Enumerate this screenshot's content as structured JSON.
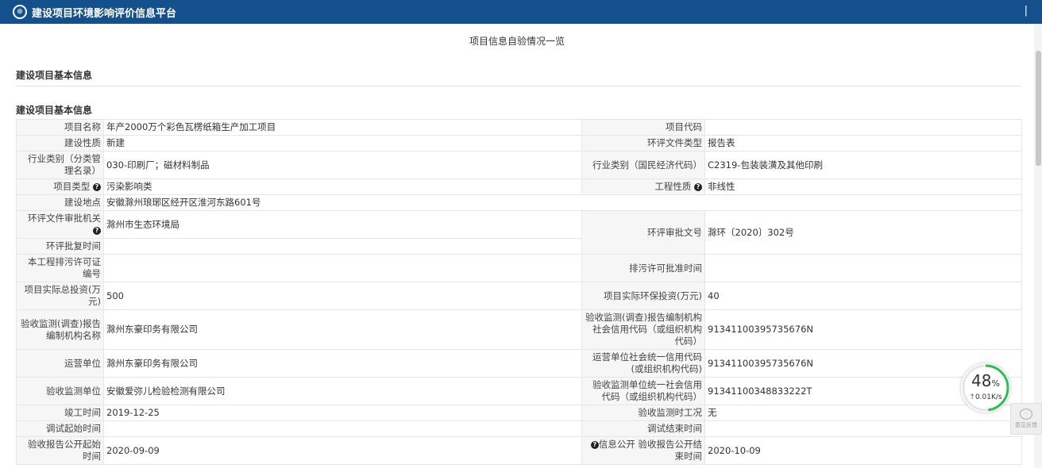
{
  "header": {
    "title": "建设项目环境影响评价信息平台",
    "logo_text": "⊕",
    "right_mark": "|"
  },
  "page_heading": "项目信息自验情况一览",
  "section1_title": "建设项目基本信息",
  "section2_title": "建设项目基本信息",
  "fields": {
    "project_name_label": "项目名称",
    "project_name": "年产2000万个彩色瓦楞纸箱生产加工项目",
    "project_code_label": "项目代码",
    "project_code": "",
    "nature_label": "建设性质",
    "nature": "新建",
    "doc_type_label": "环评文件类型",
    "doc_type": "报告表",
    "industry_cat_label": "行业类别（分类管理名录）",
    "industry_cat": "030-印刷厂；磁材料制品",
    "industry_nat_label": "行业类别（国民经济代码）",
    "industry_nat": "C2319-包装装潢及其他印刷",
    "project_type_label": "项目类型",
    "project_type": "污染影响类",
    "eng_nature_label": "工程性质",
    "eng_nature": "非线性",
    "location_label": "建设地点",
    "location": "安徽滁州琅琊区经开区淮河东路601号",
    "approval_org_label": "环评文件审批机关",
    "approval_org": "滁州市生态环境局",
    "approval_no_label": "环评审批文号",
    "approval_no": "滁环〔2020〕302号",
    "approval_time_label": "环评批复时间",
    "approval_time": "",
    "permit_no_label": "本工程排污许可证编号",
    "permit_no": "",
    "permit_time_label": "排污许可批准时间",
    "permit_time": "",
    "total_invest_label": "项目实际总投资(万元)",
    "total_invest": "500",
    "env_invest_label": "项目实际环保投资(万元)",
    "env_invest": "40",
    "report_org_label": "验收监测(调查)报告编制机构名称",
    "report_org": "滁州东豪印务有限公司",
    "report_org_code_label": "验收监测(调查)报告编制机构社会信用代码（或组织机构代码）",
    "report_org_code": "91341100395735676N",
    "operator_label": "运营单位",
    "operator": "滁州东豪印务有限公司",
    "operator_code_label": "运营单位社会统一信用代码(或组织机构代码)",
    "operator_code": "91341100395735676N",
    "monitor_org_label": "验收监测单位",
    "monitor_org": "安徽爱弥儿检验检测有限公司",
    "monitor_org_code_label": "验收监测单位统一社会信用代码（或组织机构代码）",
    "monitor_org_code": "91341100348833222T",
    "completion_time_label": "竣工时间",
    "completion_time": "2019-12-25",
    "monitor_status_label": "验收监测时工况",
    "monitor_status": "无",
    "debug_start_label": "调试起始时间",
    "debug_start": "",
    "debug_end_label": "调试结束时间",
    "debug_end": "",
    "publish_start_label": "验收报告公开起始时间",
    "publish_start": "2020-09-09",
    "info_public_label": "信息公开",
    "publish_end_label": "验收报告公开结束时间",
    "publish_end": "2020-10-09"
  },
  "help_glyph": "?",
  "speed_widget": {
    "percent": "48",
    "percent_unit": "%",
    "rate": "0.01K/s",
    "arrow": "↑",
    "level": 0.48
  },
  "feedback_widget": {
    "label": "意见反馈",
    "glyph": "··"
  },
  "colors": {
    "header_bg": "#14508c",
    "label_bg": "#f6f6f6",
    "speed_ring": "#2dbe4f"
  }
}
